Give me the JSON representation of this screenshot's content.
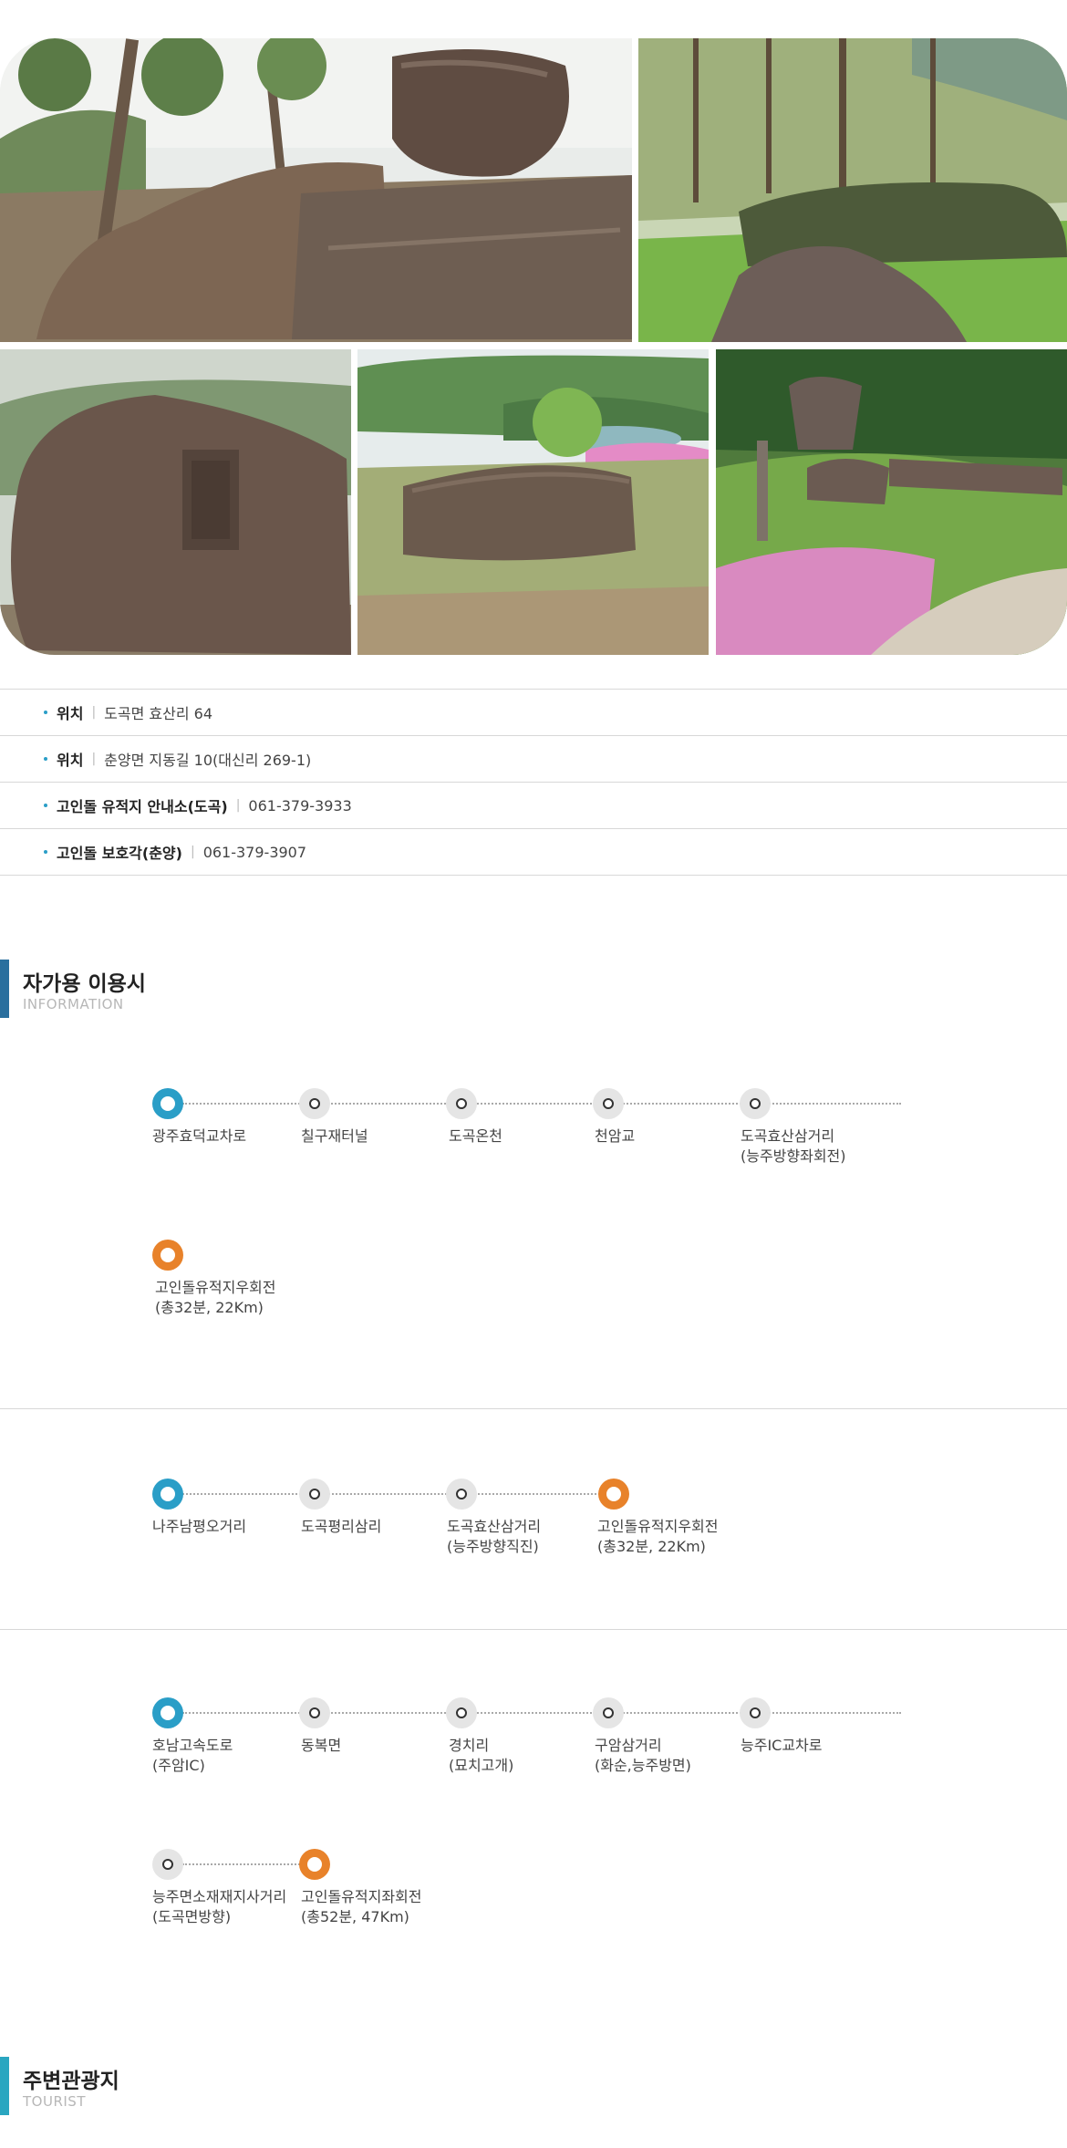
{
  "info": [
    {
      "label": "위치",
      "value": "도곡면 효산리 64"
    },
    {
      "label": "위치",
      "value": "춘양면 지동길 10(대신리 269-1)"
    },
    {
      "label": "고인돌 유적지 안내소(도곡)",
      "value": "061-379-3933"
    },
    {
      "label": "고인돌 보호각(춘양)",
      "value": "061-379-3907"
    }
  ],
  "info_separator": "|",
  "sections": {
    "information": {
      "title": "자가용 이용시",
      "subtitle": "INFORMATION"
    },
    "tourist": {
      "title": "주변관광지",
      "subtitle": "TOURIST"
    }
  },
  "routes": [
    {
      "stops": [
        "광주효덕교차로",
        "칠구재터널",
        "도곡온천",
        "천암교",
        "도곡효산삼거리\n(능주방향좌회전)",
        "고인돌유적지우회전\n(총32분, 22Km)"
      ]
    },
    {
      "stops": [
        "나주남평오거리",
        "도곡평리삼리",
        "도곡효산삼거리\n(능주방향직진)",
        "고인돌유적지우회전\n(총32분, 22Km)"
      ]
    },
    {
      "stops": [
        "호남고속도로\n(주암IC)",
        "동복면",
        "경치리\n(묘치고개)",
        "구암삼거리\n(화순,능주방면)",
        "능주IC교차로",
        "능주면소재재지사거리\n(도곡면방향)",
        "고인돌유적지좌회전\n(총52분, 47Km)"
      ]
    }
  ],
  "colors": {
    "start_node": "#2a9ec7",
    "end_node": "#e8822a",
    "information_bar": "#2a6f9e",
    "tourist_bar": "#2aa6c0"
  }
}
